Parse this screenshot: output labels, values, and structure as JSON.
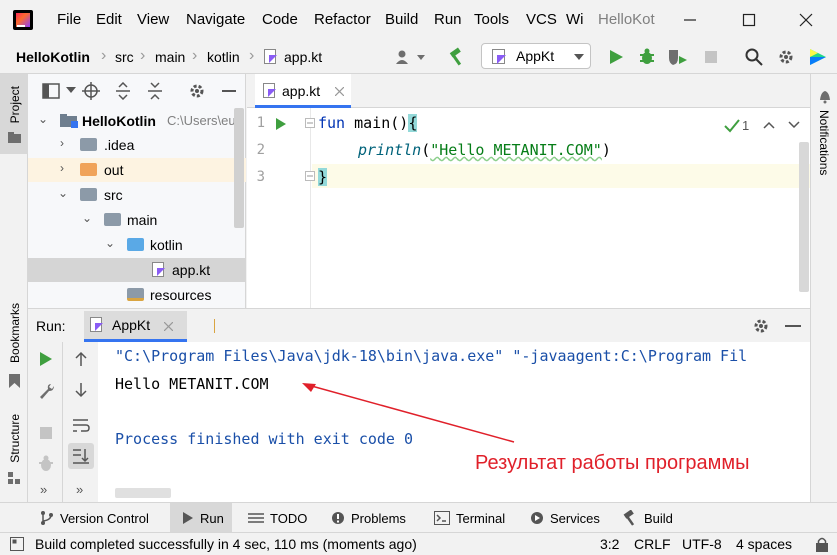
{
  "menu": {
    "items": [
      "File",
      "Edit",
      "View",
      "Navigate",
      "Code",
      "Refactor",
      "Build",
      "Run",
      "Tools",
      "VCS",
      "Wi"
    ],
    "window_title": "HelloKot"
  },
  "breadcrumb": [
    "HelloKotlin",
    "src",
    "main",
    "kotlin",
    "app.kt"
  ],
  "run_config": {
    "label": "AppKt"
  },
  "left_strip": {
    "project": "Project",
    "bookmarks": "Bookmarks",
    "structure": "Structure"
  },
  "right_strip": {
    "notifications": "Notifications"
  },
  "project_tree": [
    {
      "label": "HelloKotlin",
      "path": "C:\\Users\\eug"
    },
    {
      "label": ".idea"
    },
    {
      "label": "out"
    },
    {
      "label": "src"
    },
    {
      "label": "main"
    },
    {
      "label": "kotlin"
    },
    {
      "label": "app.kt"
    },
    {
      "label": "resources"
    }
  ],
  "editor": {
    "tab_label": "app.kt",
    "line_numbers": [
      "1",
      "2",
      "3"
    ],
    "inspection_count": "1",
    "code": {
      "l1_kw": "fun",
      "l1_name": " main()",
      "l1_brace": "{",
      "l2_fn": "println",
      "l2_open": "(",
      "l2_str": "\"Hello METANIT.COM\"",
      "l2_close": ")",
      "l3_brace": "}"
    }
  },
  "run_panel": {
    "label": "Run:",
    "tab_label": "AppKt",
    "console": {
      "command": "\"C:\\Program Files\\Java\\jdk-18\\bin\\java.exe\" \"-javaagent:C:\\Program Fil",
      "output": "Hello METANIT.COM",
      "finished": "Process finished with exit code 0"
    },
    "annotation": "Результат работы программы"
  },
  "bottom_tabs": [
    "Version Control",
    "Run",
    "TODO",
    "Problems",
    "Terminal",
    "Services",
    "Build"
  ],
  "status": {
    "message": "Build completed successfully in 4 sec, 110 ms (moments ago)",
    "position": "3:2",
    "line_sep": "CRLF",
    "encoding": "UTF-8",
    "indent": "4 spaces"
  },
  "colors": {
    "keyword": "#0033b3",
    "string": "#067d17",
    "function_call": "#00627a",
    "run_green": "#3f9f3f",
    "console_blue": "#1a4fa8",
    "annotation_red": "#e0202a",
    "selection_tab": "#3574f0"
  }
}
